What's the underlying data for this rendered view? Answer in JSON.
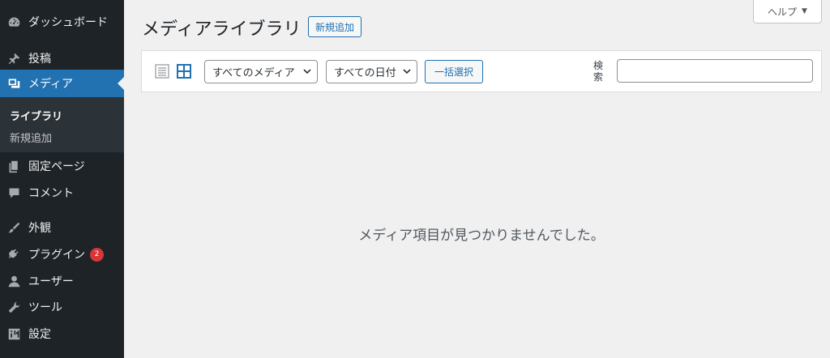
{
  "sidebar": {
    "items": [
      {
        "label": "ダッシュボード",
        "icon": "dashboard-icon"
      },
      {
        "label": "投稿",
        "icon": "pushpin-icon"
      },
      {
        "label": "メディア",
        "icon": "media-icon"
      },
      {
        "label": "固定ページ",
        "icon": "pages-icon"
      },
      {
        "label": "コメント",
        "icon": "comment-icon"
      },
      {
        "label": "外観",
        "icon": "paintbrush-icon"
      },
      {
        "label": "プラグイン",
        "icon": "plugin-icon",
        "badge": "2"
      },
      {
        "label": "ユーザー",
        "icon": "user-icon"
      },
      {
        "label": "ツール",
        "icon": "wrench-icon"
      },
      {
        "label": "設定",
        "icon": "settings-icon"
      }
    ],
    "submenu": [
      {
        "label": "ライブラリ"
      },
      {
        "label": "新規追加"
      }
    ]
  },
  "header": {
    "title": "メディアライブラリ",
    "add_new": "新規追加",
    "help": "ヘルプ",
    "help_arrow": "▼"
  },
  "toolbar": {
    "media_filter": "すべてのメディア",
    "date_filter": "すべての日付",
    "bulk_select": "一括選択",
    "search_label": "検索",
    "search_value": ""
  },
  "main": {
    "empty_message": "メディア項目が見つかりませんでした。"
  },
  "colors": {
    "sidebar_bg": "#1d2327",
    "active": "#2271b1",
    "badge": "#d63638"
  }
}
